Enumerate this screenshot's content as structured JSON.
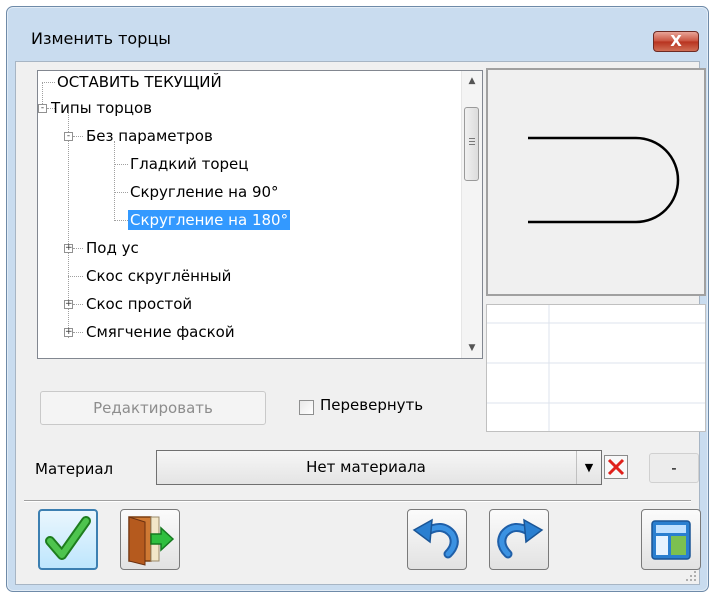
{
  "window": {
    "title": "Изменить торцы",
    "close_label": "X"
  },
  "tree": {
    "items": [
      {
        "label": "ОСТАВИТЬ ТЕКУЩИЙ"
      },
      {
        "label": "Типы торцов",
        "expander": "-"
      },
      {
        "label": "Без параметров",
        "expander": "-"
      },
      {
        "label": "Гладкий торец"
      },
      {
        "label": "Скругление на 90°"
      },
      {
        "label": "Скругление на 180°",
        "selected": true
      },
      {
        "label": "Под ус",
        "expander": "+"
      },
      {
        "label": "Скос скруглённый"
      },
      {
        "label": "Скос простой",
        "expander": "+"
      },
      {
        "label": "Смягчение фаской",
        "expander": "+"
      }
    ]
  },
  "buttons": {
    "edit_label": "Редактировать"
  },
  "flip_checkbox": {
    "label": "Перевернуть",
    "checked": false
  },
  "material": {
    "label": "Материал",
    "value": "Нет материала",
    "side_value": "-"
  },
  "toolbar": {
    "icons": [
      "ok-check-icon",
      "exit-door-icon",
      "undo-icon",
      "redo-icon",
      "layout-icon"
    ]
  },
  "colors": {
    "selection": "#3399ff",
    "accent_green": "#2fa02f",
    "accent_blue": "#2a7fd0"
  }
}
